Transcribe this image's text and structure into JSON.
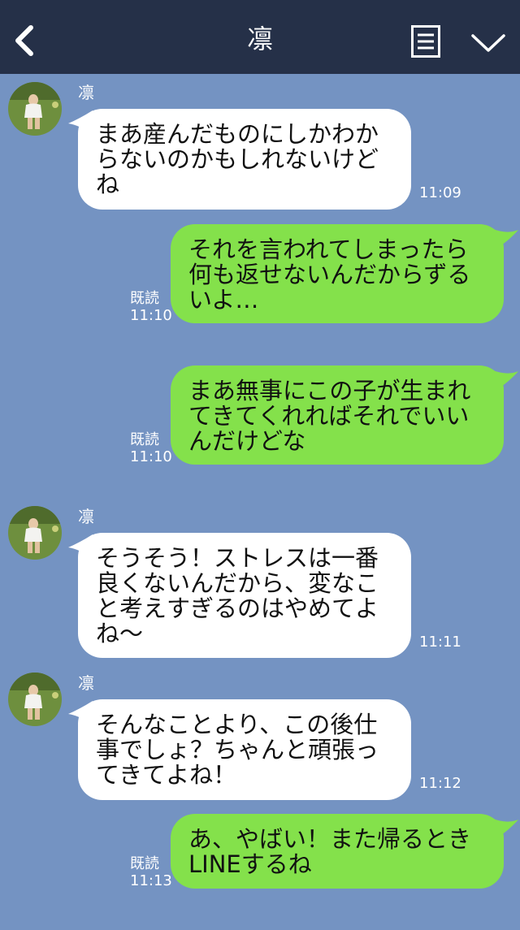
{
  "header": {
    "title": "凛",
    "back_icon": "chevron-left-icon",
    "menu_icon": "menu-icon",
    "dropdown_icon": "chevron-down-icon",
    "bg_color": "#253048"
  },
  "chat_bg_color": "#7493c2",
  "messages": [
    {
      "side": "in",
      "sender": "凛",
      "text": "まあ産んだものにしかわか\nらないのかもしれないけど\nね",
      "time": "11:09"
    },
    {
      "side": "out",
      "status": "既読",
      "text": "それを言われてしまったら\n何も返せないんだからずる\nいよ…",
      "time": "11:10"
    },
    {
      "side": "out",
      "status": "既読",
      "text": "まあ無事にこの子が生まれ\nてきてくれればそれでいい\nんだけどな",
      "time": "11:10"
    },
    {
      "side": "in",
      "sender": "凛",
      "text": "そうそう！ストレスは一番\n良くないんだから、変なこ\nと考えすぎるのはやめてよ\nね〜",
      "time": "11:11"
    },
    {
      "side": "in",
      "sender": "凛",
      "text": "そんなことより、この後仕\n事でしょ？ちゃんと頑張っ\nてきてよね！",
      "time": "11:12"
    },
    {
      "side": "out",
      "status": "既読",
      "text": "あ、やばい！また帰るとき\nLINEするね",
      "time": "11:13"
    }
  ]
}
